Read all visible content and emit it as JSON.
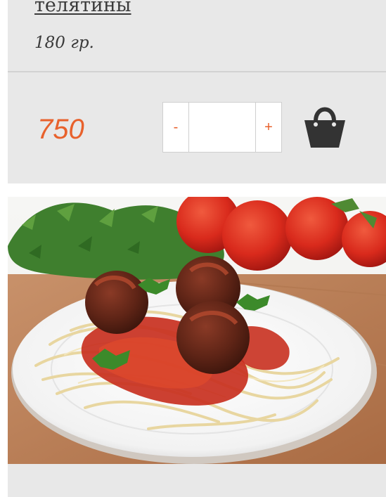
{
  "product": {
    "name": "телятины",
    "weight": "180 гр.",
    "price": "750"
  },
  "quantity": {
    "minus_label": "-",
    "plus_label": "+",
    "value": ""
  },
  "cart": {
    "icon": "shopping-bag-icon"
  },
  "photo": {
    "subject": "spaghetti-with-meatballs"
  },
  "colors": {
    "accent": "#e8612c",
    "card_bg": "#e8e8e8",
    "text": "#3a3a3a",
    "icon": "#333333"
  }
}
